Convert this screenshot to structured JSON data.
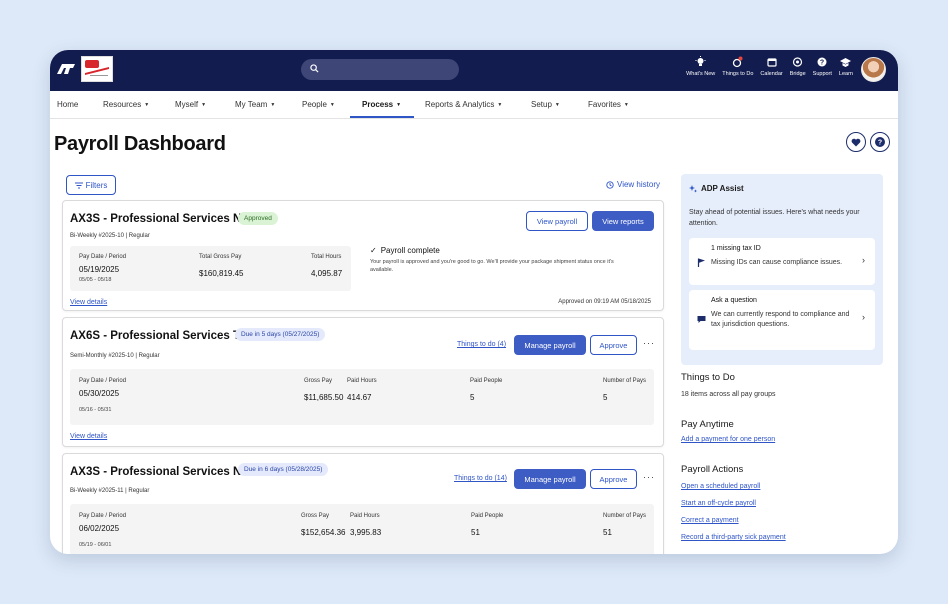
{
  "search": {
    "placeholder": ""
  },
  "top_actions": [
    {
      "icon": "lightbulb-icon",
      "label": "What's New"
    },
    {
      "icon": "things-to-do-icon",
      "label": "Things to Do"
    },
    {
      "icon": "calendar-icon",
      "label": "Calendar"
    },
    {
      "icon": "bridge-icon",
      "label": "Bridge"
    },
    {
      "icon": "support-icon",
      "label": "Support"
    },
    {
      "icon": "learn-icon",
      "label": "Learn"
    }
  ],
  "nav": {
    "home": "Home",
    "resources": "Resources",
    "myself": "Myself",
    "my_team": "My Team",
    "people": "People",
    "process": "Process",
    "reports": "Reports & Analytics",
    "setup": "Setup",
    "favorites": "Favorites"
  },
  "page": {
    "title": "Payroll Dashboard"
  },
  "toolbar": {
    "filters_label": "Filters",
    "view_history_label": "View history"
  },
  "cards": [
    {
      "name": "AX3S - Professional Services N...",
      "badge": "Approved",
      "sub": "Bi-Weekly #2025-10 | Regular",
      "view_payroll": "View payroll",
      "view_reports": "View reports",
      "pay_date_header": "Pay Date / Period",
      "pay_date": "05/19/2025",
      "period": "05/05 - 05/18",
      "gross_header": "Total Gross Pay",
      "gross": "$160,819.45",
      "hours_header": "Total Hours",
      "hours": "4,095.87",
      "complete_title": "Payroll complete",
      "complete_desc": "Your payroll is approved and you're good to go. We'll provide your package shipment status once it's available.",
      "approved_on": "Approved on 09:19 AM 05/18/2025",
      "view_details": "View details"
    },
    {
      "name": "AX6S - Professional Services T...",
      "badge": "Due in 5 days (05/27/2025)",
      "sub": "Semi-Monthly #2025-10 | Regular",
      "things_to_do": "Things to do (4)",
      "manage": "Manage payroll",
      "approve": "Approve",
      "pay_date_header": "Pay Date / Period",
      "pay_date": "05/30/2025",
      "period": "05/16 - 05/31",
      "gross_header": "Gross Pay",
      "gross": "$11,685.50",
      "hours_header": "Paid Hours",
      "hours": "414.67",
      "people_header": "Paid People",
      "people": "5",
      "pays_header": "Number of Pays",
      "pays": "5",
      "view_details": "View details"
    },
    {
      "name": "AX3S - Professional Services N...",
      "badge": "Due in 6 days (05/28/2025)",
      "sub": "Bi-Weekly #2025-11 | Regular",
      "things_to_do": "Things to do (14)",
      "manage": "Manage payroll",
      "approve": "Approve",
      "pay_date_header": "Pay Date / Period",
      "pay_date": "06/02/2025",
      "period": "05/19 - 06/01",
      "gross_header": "Gross Pay",
      "gross": "$152,654.36",
      "hours_header": "Paid Hours",
      "hours": "3,995.83",
      "people_header": "Paid People",
      "people": "51",
      "pays_header": "Number of Pays",
      "pays": "51"
    }
  ],
  "assist": {
    "title": "ADP Assist",
    "desc": "Stay ahead of potential issues. Here's what needs your attention.",
    "items": [
      {
        "title": "1 missing tax ID",
        "desc": "Missing IDs can cause compliance issues."
      },
      {
        "title": "Ask a question",
        "desc": "We can currently respond to compliance and tax jurisdiction questions."
      }
    ]
  },
  "right": {
    "things_title": "Things to Do",
    "things_desc": "18 items across all pay groups",
    "pay_anytime_title": "Pay Anytime",
    "pay_anytime_link": "Add a payment for one person",
    "actions_title": "Payroll Actions",
    "actions": [
      "Open a scheduled payroll",
      "Start an off-cycle payroll",
      "Correct a payment",
      "Record a third-party sick payment"
    ]
  },
  "colors": {
    "topbar": "#121c4e",
    "accent": "#2f55c7",
    "button": "#3d5cc4",
    "approved_bg": "#d9f3d4",
    "assist_bg": "#e7eefb"
  }
}
